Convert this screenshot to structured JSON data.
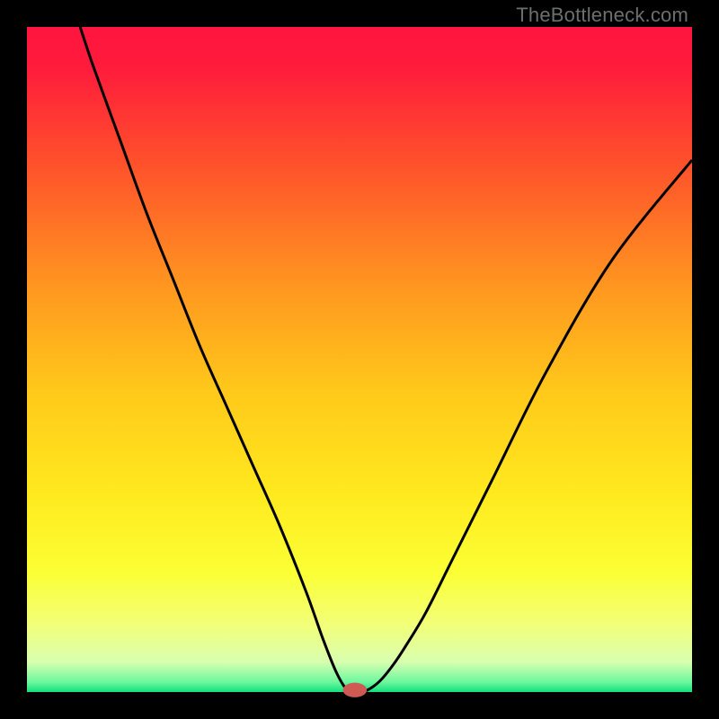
{
  "watermark": "TheBottleneck.com",
  "chart_data": {
    "type": "line",
    "title": "",
    "xlabel": "",
    "ylabel": "",
    "xlim": [
      0,
      100
    ],
    "ylim": [
      0,
      100
    ],
    "grid": false,
    "legend": false,
    "gradient_stops": [
      {
        "pos": 0.0,
        "color": "#ff153f"
      },
      {
        "pos": 0.06,
        "color": "#ff1b3c"
      },
      {
        "pos": 0.2,
        "color": "#ff4f2b"
      },
      {
        "pos": 0.4,
        "color": "#ff9a1f"
      },
      {
        "pos": 0.55,
        "color": "#ffc91a"
      },
      {
        "pos": 0.7,
        "color": "#ffe91e"
      },
      {
        "pos": 0.82,
        "color": "#fbff34"
      },
      {
        "pos": 0.9,
        "color": "#f2ff7a"
      },
      {
        "pos": 0.955,
        "color": "#d8ffb0"
      },
      {
        "pos": 0.985,
        "color": "#6cf79e"
      },
      {
        "pos": 1.0,
        "color": "#12e07a"
      }
    ],
    "series": [
      {
        "name": "bottleneck-curve",
        "color": "#000000",
        "x": [
          8,
          10,
          14,
          18,
          22,
          26,
          30,
          34,
          38,
          42,
          44.5,
          46.5,
          48,
          49.5,
          51,
          53,
          55,
          57,
          60,
          64,
          70,
          78,
          88,
          100
        ],
        "y": [
          100,
          94,
          83,
          72,
          62,
          52,
          43,
          34,
          25,
          15,
          8,
          3,
          0.5,
          0,
          0.2,
          1.6,
          4.0,
          7.0,
          12,
          20,
          32,
          48,
          65,
          80
        ]
      }
    ],
    "marker": {
      "x": 49.3,
      "y": 0.3,
      "rx": 1.8,
      "ry": 1.1,
      "fill": "#cf5a53"
    }
  }
}
